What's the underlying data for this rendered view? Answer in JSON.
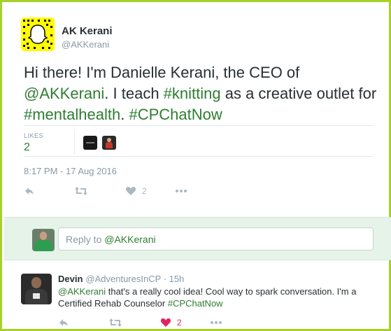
{
  "tweet": {
    "author_name": "AK Kerani",
    "author_handle": "@AKKerani",
    "text_parts": [
      {
        "t": "Hi there! I'm Danielle Kerani, the CEO of ",
        "tag": false
      },
      {
        "t": "@AKKerani",
        "tag": true
      },
      {
        "t": ". I teach ",
        "tag": false
      },
      {
        "t": "#knitting",
        "tag": true
      },
      {
        "t": " as a creative outlet for ",
        "tag": false
      },
      {
        "t": "#mentalhealth",
        "tag": true
      },
      {
        "t": ". ",
        "tag": false
      },
      {
        "t": "#CPChatNow",
        "tag": true
      }
    ],
    "likes_label": "LIKES",
    "likes_count": "2",
    "timestamp": "8:17 PM - 17 Aug 2016",
    "actions": {
      "reply_icon": "reply-icon",
      "retweet_icon": "retweet-icon",
      "like_icon": "heart-icon",
      "like_count": "2",
      "more_icon": "more-icon"
    }
  },
  "reply_box": {
    "placeholder_prefix": "Reply to ",
    "placeholder_mention": "@AKKerani"
  },
  "comment": {
    "name": "Devin",
    "handle": "@AdventuresInCP",
    "separator": " · ",
    "time": "15h",
    "text_parts": [
      {
        "t": "@AKKerani",
        "tag": true
      },
      {
        "t": " that's a really cool idea! Cool way to spark conversation. I'm a Certified Rehab Counselor ",
        "tag": false
      },
      {
        "t": "#CPChatNow",
        "tag": true
      }
    ],
    "like_count": "2"
  },
  "colors": {
    "frame": "#a7d129",
    "link_green": "#2e7d32",
    "reply_bg": "#e6f3e8",
    "liked_heart": "#e0245e",
    "muted": "#aab8c2"
  }
}
